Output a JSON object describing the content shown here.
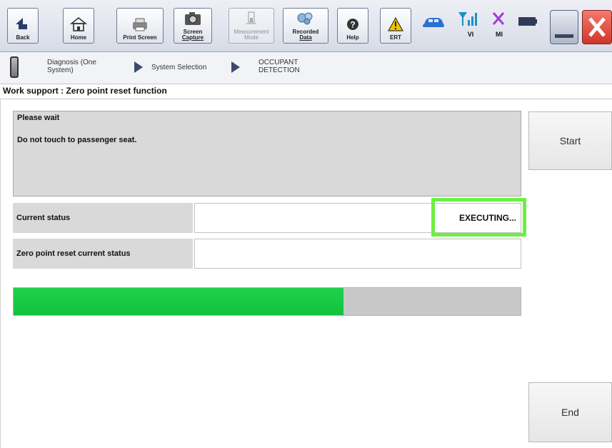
{
  "toolbar": {
    "buttons": [
      {
        "label": "Back",
        "icon": "back-arrow-icon"
      },
      {
        "label": "Home",
        "icon": "home-icon"
      },
      {
        "label": "Print Screen",
        "icon": "printer-icon"
      },
      {
        "label_line1": "Screen",
        "label_line2": "Capture",
        "icon": "camera-icon"
      },
      {
        "label_line1": "Measurement",
        "label_line2": "Mode",
        "icon": "measurement-icon",
        "disabled": true
      },
      {
        "label_line1": "Recorded",
        "label_line2": "Data",
        "icon": "recorded-data-icon"
      },
      {
        "label": "Help",
        "icon": "help-icon"
      },
      {
        "label": "ERT",
        "icon": "warning-icon"
      }
    ],
    "status_icons": [
      {
        "icon": "car-icon"
      },
      {
        "label": "VI",
        "icon": "signal-icon"
      },
      {
        "label": "MI",
        "icon": "x-mark-icon"
      },
      {
        "icon": "battery-icon"
      }
    ]
  },
  "breadcrumb": {
    "item1_line1": "Diagnosis (One",
    "item1_line2": "System)",
    "item2": "System Selection",
    "item3_line1": "OCCUPANT",
    "item3_line2": "DETECTION"
  },
  "page_title": "Work support : Zero point reset function",
  "message": {
    "line1": "Please  wait",
    "line2": "Do not touch to passenger seat."
  },
  "buttons": {
    "start": "Start",
    "end": "End"
  },
  "status": {
    "current_label": "Current status",
    "current_value": "EXECUTING...",
    "reset_label": "Zero point reset current status",
    "reset_value": ""
  },
  "progress": {
    "fraction": 0.65
  },
  "colors": {
    "progress": "#1fd14a",
    "highlight": "#6cf043",
    "close": "#e03a2f"
  }
}
